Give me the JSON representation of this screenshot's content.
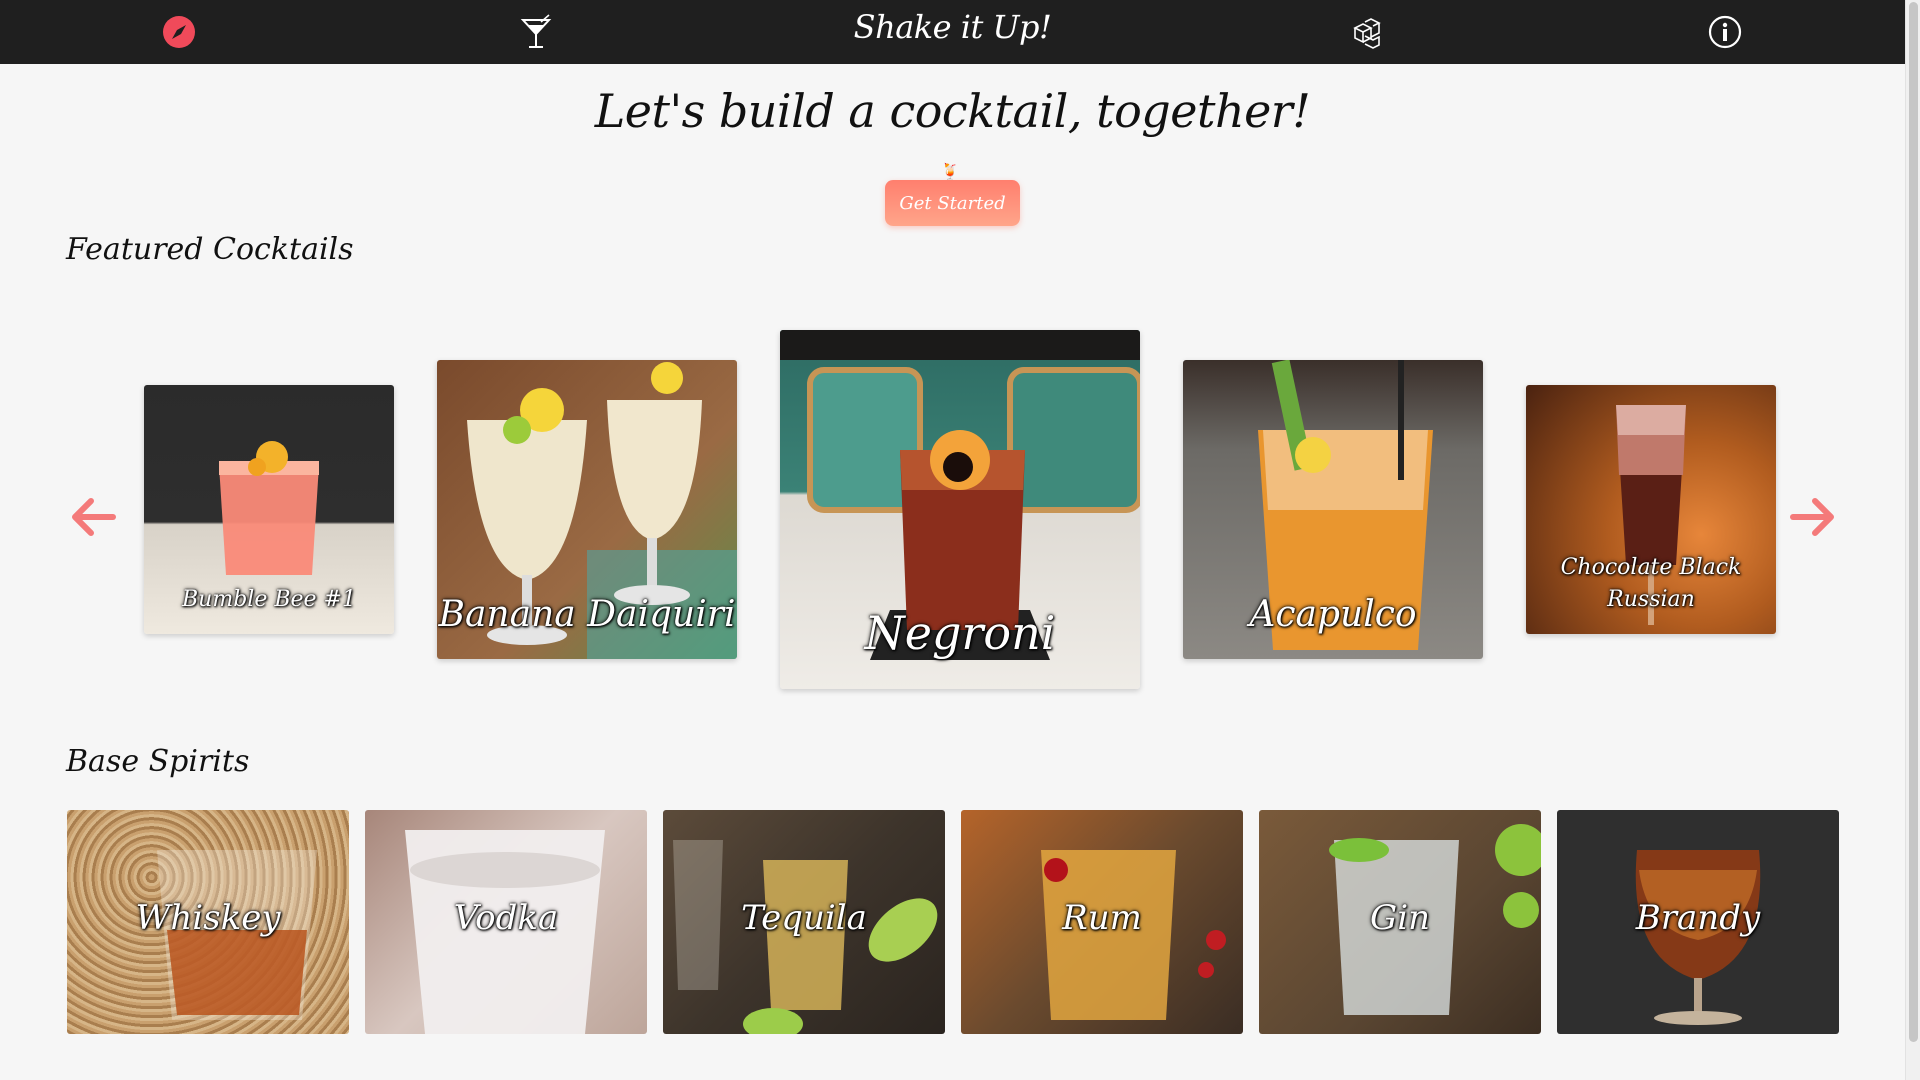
{
  "nav": {
    "title": "Shake it Up!",
    "icons": [
      "compass-icon",
      "cocktail-glass-icon",
      "ice-cubes-icon",
      "info-icon"
    ]
  },
  "hero": {
    "title": "Let's build a cocktail, together!",
    "cta_label": "Get Started"
  },
  "featured": {
    "heading": "Featured Cocktails",
    "cards": [
      {
        "name": "Bumble Bee #1"
      },
      {
        "name": "Banana Daiquiri"
      },
      {
        "name": "Negroni"
      },
      {
        "name": "Acapulco"
      },
      {
        "name": "Chocolate Black Russian"
      }
    ]
  },
  "spirits": {
    "heading": "Base Spirits",
    "items": [
      {
        "name": "Whiskey"
      },
      {
        "name": "Vodka"
      },
      {
        "name": "Tequila"
      },
      {
        "name": "Rum"
      },
      {
        "name": "Gin"
      },
      {
        "name": "Brandy"
      }
    ]
  },
  "colors": {
    "nav_bg": "#1f1f1f",
    "accent": "#ff7f6e",
    "page_bg": "#f6f6f6"
  }
}
